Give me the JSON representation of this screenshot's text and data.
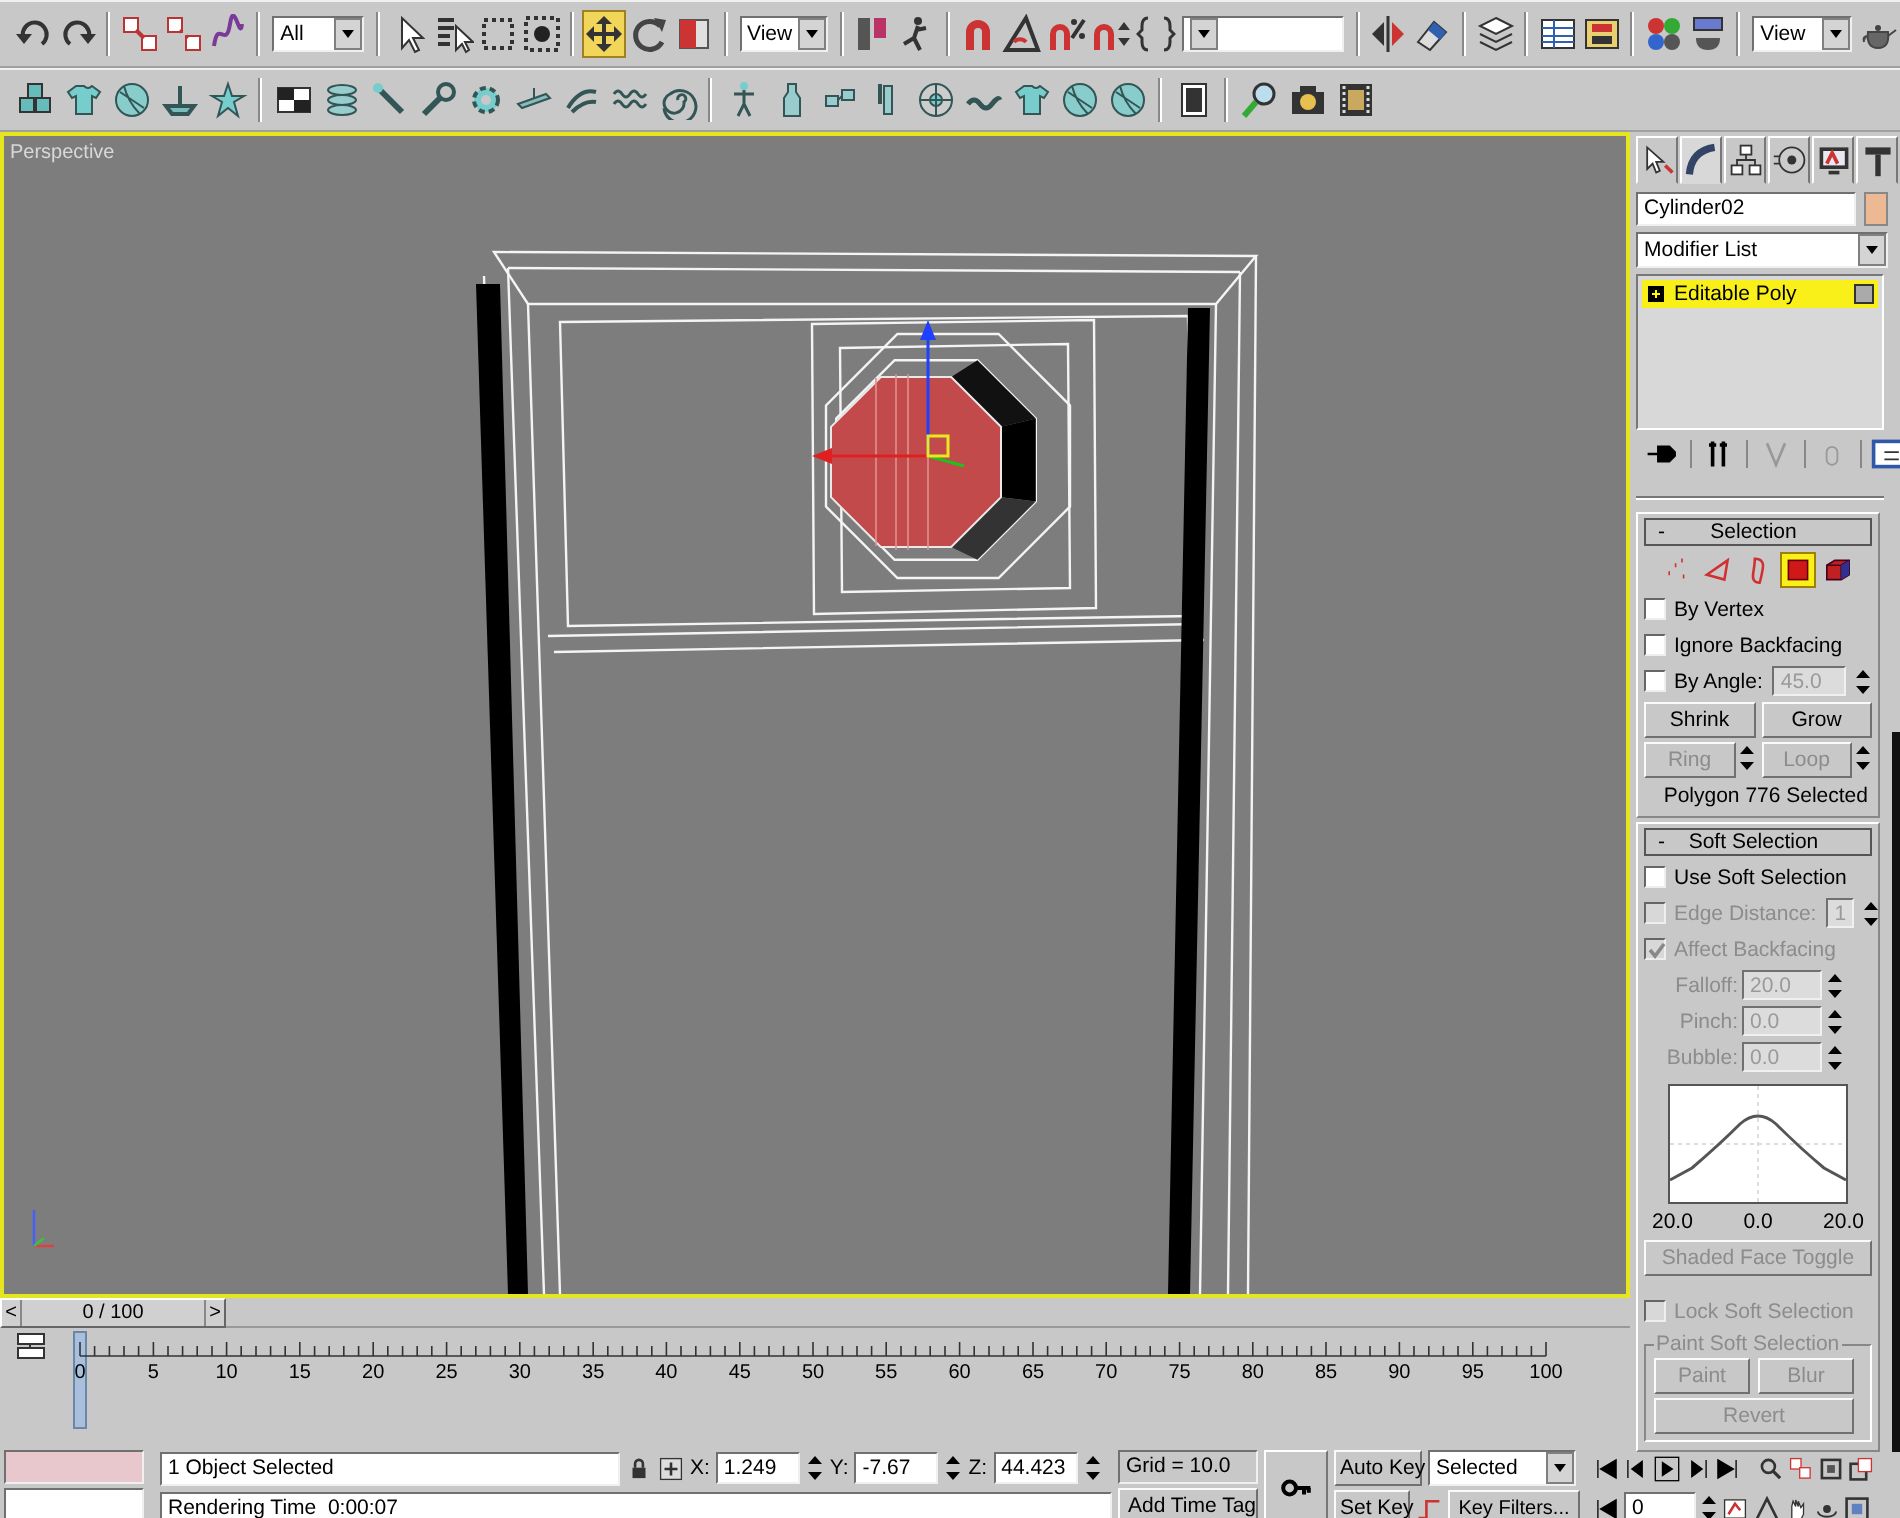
{
  "toolbar_main": [
    {
      "kind": "button",
      "selected": false
    },
    {
      "kind": "button",
      "selected": false
    },
    {
      "kind": "button",
      "selected": false
    },
    {
      "kind": "button",
      "selected": false
    },
    {
      "kind": "button",
      "selected": false
    },
    {
      "kind": "dropdown",
      "value": "All"
    },
    {
      "kind": "button",
      "selected": false
    },
    {
      "kind": "button",
      "selected": false
    },
    {
      "kind": "button",
      "selected": false
    },
    {
      "kind": "button",
      "selected": false
    },
    {
      "kind": "button",
      "selected": true
    },
    {
      "kind": "button",
      "selected": false
    },
    {
      "kind": "button",
      "selected": false
    },
    {
      "kind": "dropdown",
      "value": "View"
    },
    {
      "kind": "button",
      "selected": false
    },
    {
      "kind": "button",
      "selected": false
    },
    {
      "kind": "button",
      "selected": false
    },
    {
      "kind": "button",
      "selected": false
    },
    {
      "kind": "button",
      "selected": false
    },
    {
      "kind": "button",
      "selected": false
    },
    {
      "kind": "button",
      "selected": false
    },
    {
      "kind": "dropdown"
    },
    {
      "kind": "button",
      "selected": false
    },
    {
      "kind": "button",
      "selected": false
    },
    {
      "kind": "button",
      "selected": false
    },
    {
      "kind": "button",
      "selected": false
    },
    {
      "kind": "button",
      "selected": false
    },
    {
      "kind": "button",
      "selected": false
    },
    {
      "kind": "button",
      "selected": false
    },
    {
      "kind": "dropdown",
      "value": "View"
    },
    {
      "kind": "button",
      "selected": false
    }
  ],
  "viewport": {
    "label": "Perspective"
  },
  "command_panel": {
    "tabs": [
      {
        "selected": false
      },
      {
        "selected": true
      },
      {
        "selected": false
      },
      {
        "selected": false
      },
      {
        "selected": false
      },
      {
        "selected": false
      }
    ],
    "object_name": "Cylinder02",
    "modifier_list": "Modifier List",
    "stack": [
      {
        "label": "Editable Poly",
        "selected": true
      }
    ],
    "selection": {
      "collapse": "-",
      "title": "Selection",
      "levels": [
        {
          "selected": false
        },
        {
          "selected": false
        },
        {
          "selected": false
        },
        {
          "selected": true
        },
        {
          "selected": false
        }
      ],
      "options": [
        {
          "kind": "checkbox",
          "label": "By Vertex",
          "checked": false,
          "disabled": false
        },
        {
          "kind": "checkbox",
          "label": "Ignore Backfacing",
          "checked": false,
          "disabled": false
        },
        {
          "kind": "spinner",
          "label": "By Angle:",
          "checked": false,
          "disabled": false,
          "value": "45.0",
          "value_disabled": true
        }
      ],
      "buttons": [
        {
          "label": "Shrink",
          "disabled": false,
          "spinner": false
        },
        {
          "label": "Grow",
          "disabled": false,
          "spinner": false
        },
        {
          "label": "Ring",
          "disabled": true,
          "spinner": true
        },
        {
          "label": "Loop",
          "disabled": true,
          "spinner": true
        }
      ],
      "status": "Polygon 776 Selected"
    },
    "soft_selection": {
      "collapse": "-",
      "title": "Soft Selection",
      "options": [
        {
          "kind": "checkbox",
          "label": "Use Soft Selection",
          "checked": false,
          "disabled": false
        },
        {
          "kind": "spinner",
          "label": "Edge Distance:",
          "checked": false,
          "disabled": true,
          "value": "1",
          "value_disabled": true
        },
        {
          "kind": "checkbox",
          "label": "Affect Backfacing",
          "checked": true,
          "disabled": true
        }
      ],
      "params": [
        {
          "label": "Falloff:",
          "value": "20.0",
          "disabled": true
        },
        {
          "label": "Pinch:",
          "value": "0.0",
          "disabled": true
        },
        {
          "label": "Bubble:",
          "value": "0.0",
          "disabled": true
        }
      ],
      "curve_labels": [
        "20.0",
        "0.0",
        "20.0"
      ],
      "shaded_face_toggle": {
        "label": "Shaded Face Toggle",
        "disabled": true
      },
      "lock": {
        "label": "Lock Soft Selection",
        "checked": false,
        "disabled": true
      },
      "paint_group": {
        "title": "Paint Soft Selection",
        "buttons": [
          {
            "label": "Paint",
            "disabled": true
          },
          {
            "label": "Blur",
            "disabled": true
          },
          {
            "label": "Revert",
            "disabled": true
          }
        ]
      }
    }
  },
  "time_slider": {
    "prev": "<",
    "label": "0 / 100",
    "next": ">",
    "level": 0
  },
  "track_bar": {
    "labels": [
      "0",
      "5",
      "10",
      "15",
      "20",
      "25",
      "30",
      "35",
      "40",
      "45",
      "50",
      "55",
      "60",
      "65",
      "70",
      "75",
      "80",
      "85",
      "90",
      "95",
      "100"
    ]
  },
  "status_bar": {
    "selection_info": "1 Object Selected",
    "prompt": "Rendering Time  0:00:07",
    "coords": [
      {
        "axis": "X:",
        "value": "1.249"
      },
      {
        "axis": "Y:",
        "value": "-7.67"
      },
      {
        "axis": "Z:",
        "value": "44.423"
      }
    ],
    "grid": "Grid = 10.0",
    "time_tag": "Add Time Tag",
    "auto_key": {
      "label": "Auto Key",
      "on": false
    },
    "key_mode": "Selected",
    "set_key": "Set Key",
    "key_filters": "Key Filters...",
    "frame": "0"
  }
}
